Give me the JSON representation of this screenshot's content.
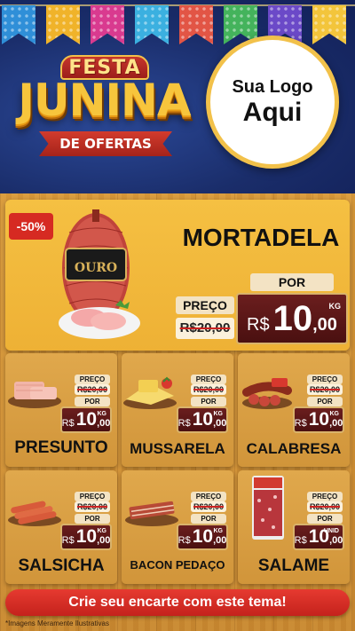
{
  "header": {
    "title_top": "FESTA",
    "title_main": "JUNINA",
    "title_ribbon": "DE OFERTAS",
    "logo_line1": "Sua Logo",
    "logo_line2": "Aqui"
  },
  "featured": {
    "badge": "-50%",
    "name": "MORTADELA",
    "brand": "OURO",
    "price_label": "PREÇO",
    "old_price": "R$20,00",
    "por_label": "POR",
    "currency": "R$",
    "price_int": "10",
    "price_dec": ",00",
    "unit": "KG"
  },
  "products": [
    {
      "name": "PRESUNTO",
      "price_label": "PREÇO",
      "old_price": "R$20,00",
      "por_label": "POR",
      "currency": "R$",
      "price_int": "10",
      "price_dec": ",00",
      "unit": "KG"
    },
    {
      "name": "MUSSARELA",
      "price_label": "PREÇO",
      "old_price": "R$20,00",
      "por_label": "POR",
      "currency": "R$",
      "price_int": "10",
      "price_dec": ",00",
      "unit": "KG"
    },
    {
      "name": "CALABRESA",
      "price_label": "PREÇO",
      "old_price": "R$20,00",
      "por_label": "POR",
      "currency": "R$",
      "price_int": "10",
      "price_dec": ",00",
      "unit": "KG"
    },
    {
      "name": "SALSICHA",
      "price_label": "PREÇO",
      "old_price": "R$20,00",
      "por_label": "POR",
      "currency": "R$",
      "price_int": "10",
      "price_dec": ",00",
      "unit": "KG"
    },
    {
      "name": "BACON PEDAÇO",
      "price_label": "PREÇO",
      "old_price": "R$20,00",
      "por_label": "POR",
      "currency": "R$",
      "price_int": "10",
      "price_dec": ",00",
      "unit": "KG"
    },
    {
      "name": "SALAME",
      "price_label": "PREÇO",
      "old_price": "R$20,00",
      "por_label": "POR",
      "currency": "R$",
      "price_int": "10",
      "price_dec": ",00",
      "unit": "UNID"
    }
  ],
  "footer": {
    "cta": "Crie seu encarte com este tema!",
    "disclaimer": "*Imagens Meramente Ilustrativas"
  },
  "colors": {
    "header_bg": "#1a2d6a",
    "accent_yellow": "#f5c042",
    "price_box": "#4a1010",
    "cta_red": "#d62a22"
  }
}
